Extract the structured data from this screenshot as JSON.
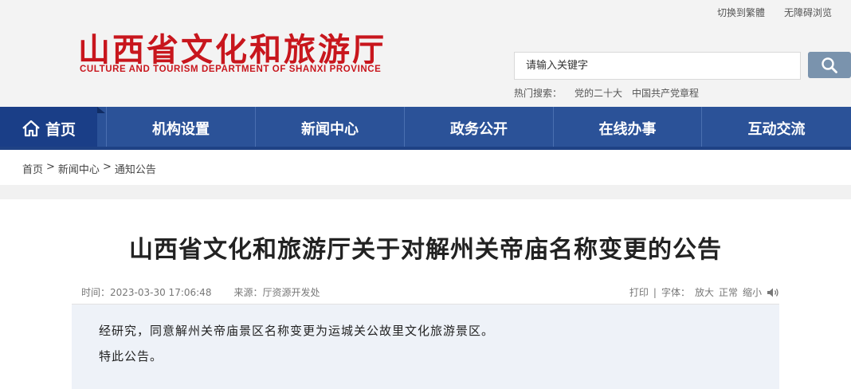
{
  "top_links": {
    "traditional": "切换到繁體",
    "accessibility": "无障碍浏览"
  },
  "logo": {
    "cn": "山西省文化和旅游厅",
    "en": "CULTURE AND TOURISM DEPARTMENT OF SHANXI PROVINCE"
  },
  "search": {
    "placeholder": "请输入关键字",
    "hot_label": "热门搜索：",
    "hot_keywords": [
      "党的二十大",
      "中国共产党章程"
    ]
  },
  "nav": {
    "home": "首页",
    "items": [
      "机构设置",
      "新闻中心",
      "政务公开",
      "在线办事",
      "互动交流"
    ]
  },
  "breadcrumb": [
    "首页",
    ">",
    "新闻中心",
    ">",
    "通知公告"
  ],
  "article": {
    "title": "山西省文化和旅游厅关于对解州关帝庙名称变更的公告",
    "time": "时间：2023-03-30 17:06:48",
    "source": "来源：厅资源开发处",
    "tools": {
      "print": "打印",
      "sep1": "|",
      "font_label": "字体：",
      "large": "放大",
      "normal": "正常",
      "small": "缩小"
    },
    "paragraphs": [
      "经研究，同意解州关帝庙景区名称变更为运城关公故里文化旅游景区。",
      "特此公告。"
    ]
  },
  "colors": {
    "brand_red": "#c8161d",
    "nav_blue": "#2b5298",
    "nav_home_blue": "#1a3e87",
    "search_btn": "#7a93ad",
    "content_bg": "#eef2f8"
  }
}
